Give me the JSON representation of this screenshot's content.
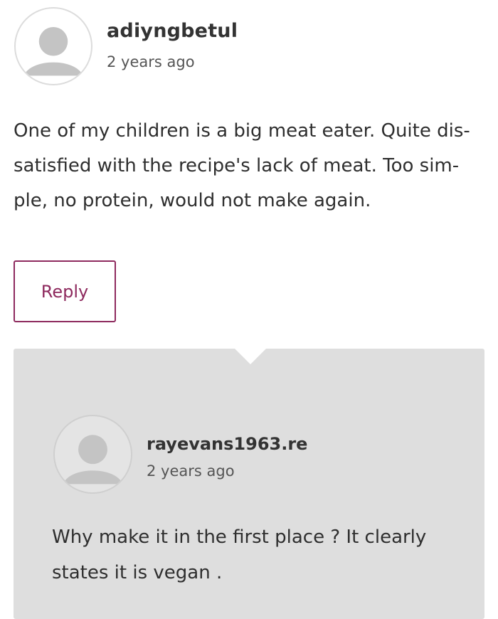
{
  "comment": {
    "avatar_icon": "default-user-avatar-icon",
    "username": "adiyngbetul",
    "time": "2 years ago",
    "body_lines": [
      "One of my children is a big meat eater. Quite dis-",
      "satisfied with the recipe's lack of meat. Too sim-",
      "ple, no protein, would not make again."
    ],
    "reply_label": "Reply"
  },
  "reply": {
    "avatar_icon": "default-user-avatar-icon",
    "username": "rayevans1963.re",
    "time": "2 years ago",
    "body_lines": [
      "Why make it in the first place ? It clearly",
      "states it is vegan ."
    ]
  },
  "colors": {
    "accent": "#8e2a5e",
    "reply_background": "#dedede",
    "avatar_gray": "#c4c4c4"
  }
}
